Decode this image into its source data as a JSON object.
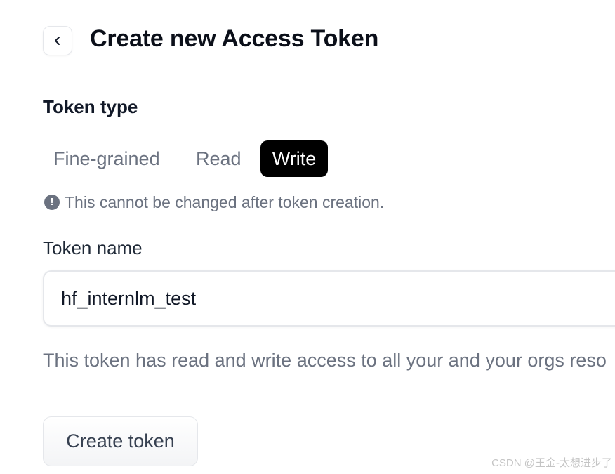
{
  "header": {
    "back_icon": "chevron-left-icon",
    "title": "Create new Access Token"
  },
  "token_type": {
    "label": "Token type",
    "options": [
      "Fine-grained",
      "Read",
      "Write"
    ],
    "selected": "Write",
    "selected_bg": "#000000",
    "selected_text_color": "#ffffff",
    "warning_icon": "exclamation-circle-icon",
    "warning_text": "This cannot be changed after token creation."
  },
  "token_name": {
    "label": "Token name",
    "value": "hf_internlm_test"
  },
  "access_description": "This token has read and write access to all your and your orgs reso",
  "actions": {
    "create_label": "Create token"
  },
  "watermark": "CSDN @王金-太想进步了"
}
